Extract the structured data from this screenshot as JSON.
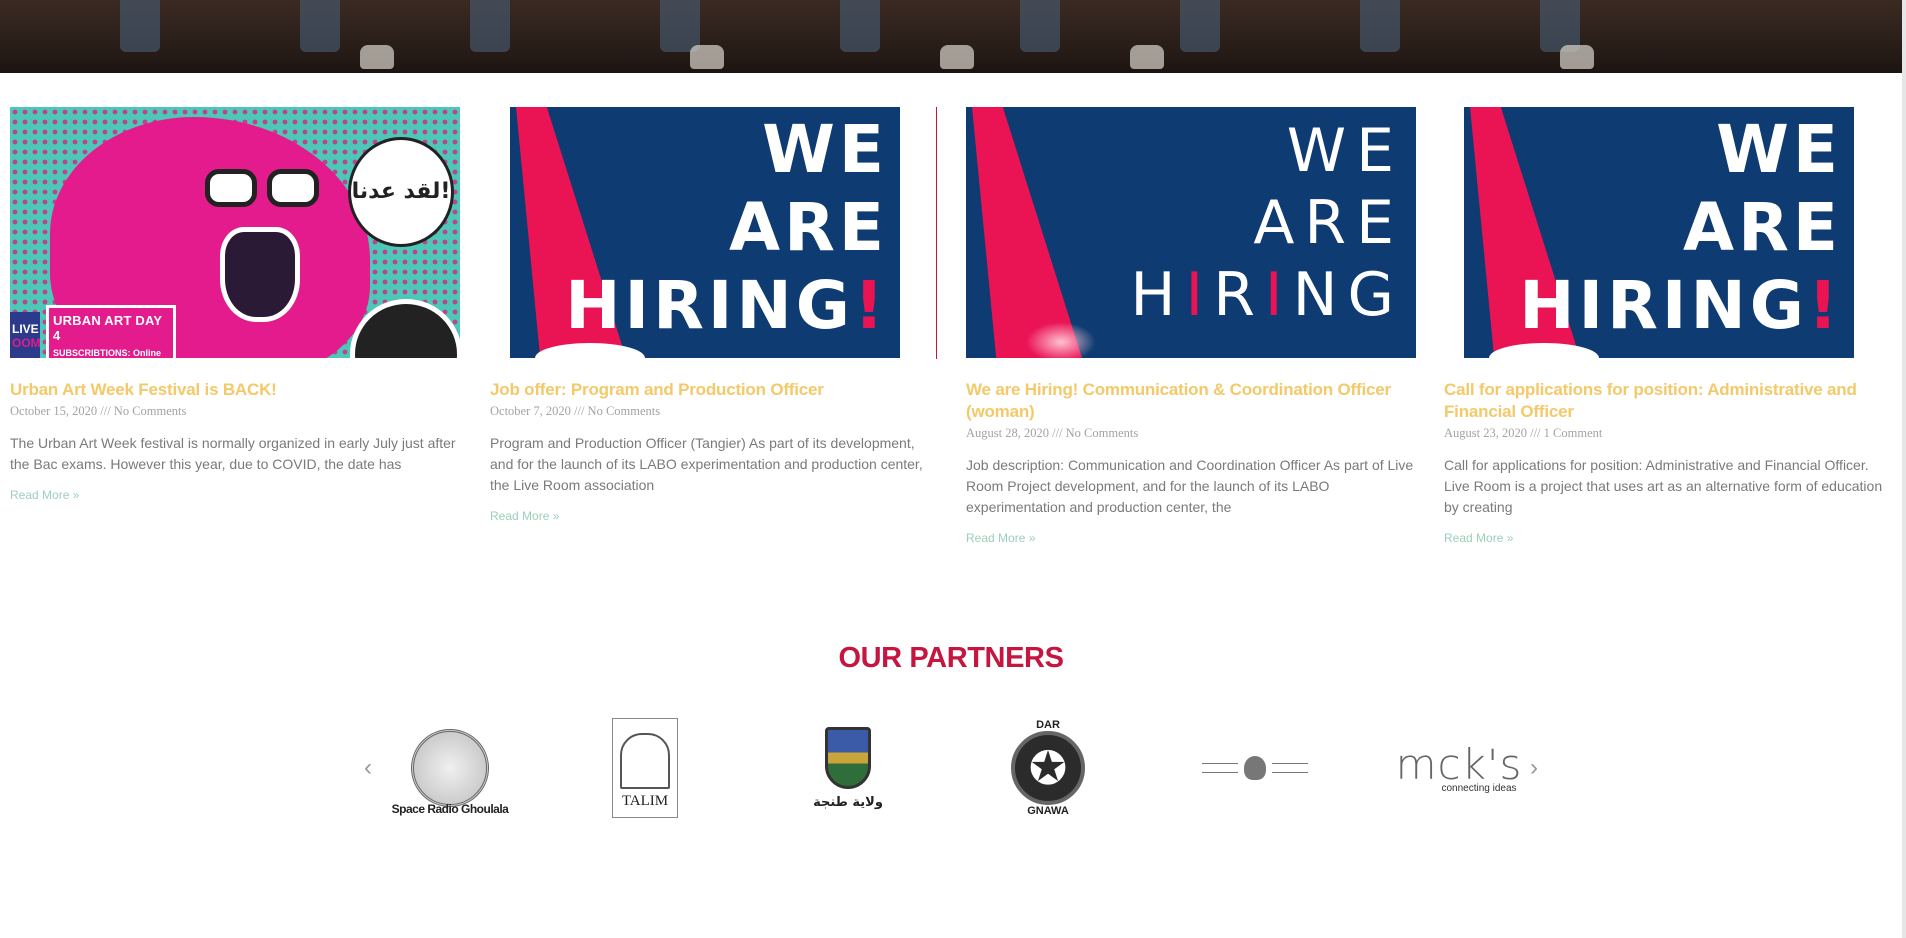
{
  "posts": [
    {
      "title": "Urban Art Week Festival is BACK!",
      "meta": "October 15, 2020 /// No Comments",
      "excerpt": "The Urban Art Week festival is normally organized in early July just after the Bac exams. However this year, due to COVID, the date has",
      "read_more": "Read More »",
      "image": {
        "bubble_text": "لقد عدنا!",
        "live_label": "LIVE",
        "live_label2": "OOM",
        "banner_title": "URBAN ART DAY 4",
        "banner_sub": "SUBSCRIBTIONS: Online"
      }
    },
    {
      "title": "Job offer: Program and Production Officer",
      "meta": "October 7, 2020 /// No Comments",
      "excerpt": "Program and Production Officer (Tangier) As part of its development, and for the launch of its LABO experimentation and production center, the Live Room association",
      "read_more": "Read More »",
      "image": {
        "line1": "WE",
        "line2": "ARE",
        "line3": "HIRING",
        "bang": "!"
      }
    },
    {
      "title": "We are Hiring! Communication & Coordination Officer (woman)",
      "meta": "August 28, 2020 /// No Comments",
      "excerpt": "Job description: Communication and Coordination Officer As part of Live Room Project development, and for the launch of its LABO experimentation and production center, the",
      "read_more": "Read More »",
      "image": {
        "line1": "WE",
        "line2": "ARE",
        "line3a": "H",
        "line3b": "I",
        "line3c": "R",
        "line3d": "I",
        "line3e": "NG"
      }
    },
    {
      "title": "Call for applications for position: Administrative and Financial Officer",
      "meta": "August 23, 2020 /// 1 Comment",
      "excerpt": "Call for applications for position: Administrative and Financial Officer. Live Room is a project that uses art as an alternative form of education by creating",
      "read_more": "Read More »",
      "image": {
        "line1": "WE",
        "line2": "ARE",
        "line3": "HIRING",
        "bang": "!"
      }
    }
  ],
  "partners": {
    "title": "OUR PARTNERS",
    "prev_arrow": "‹",
    "next_arrow": "›",
    "logos": [
      {
        "icon": "space-radio-ghoulala-logo",
        "label": "Space Radio Ghoulala"
      },
      {
        "icon": "talim-logo",
        "label": "TALIM"
      },
      {
        "icon": "wilaya-tanger-logo",
        "label": "ولاية طنجة"
      },
      {
        "icon": "dar-gnawa-logo",
        "label_top": "DAR",
        "label_bottom": "GNAWA"
      },
      {
        "icon": "ministry-of-culture-logo"
      },
      {
        "icon": "mcks-logo",
        "label": "mck's",
        "sub": "connecting ideas"
      }
    ]
  },
  "colors": {
    "post_title": "#f3c969",
    "read_more": "#9ccfb8",
    "partners_title": "#c4163f",
    "hiring_blue": "#0d3b72",
    "hiring_red": "#ea1455"
  }
}
